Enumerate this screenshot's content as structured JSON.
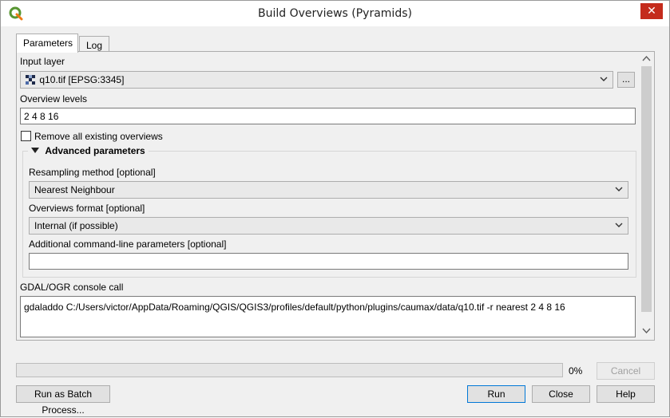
{
  "window": {
    "title": "Build Overviews (Pyramids)"
  },
  "tabs": [
    {
      "label": "Parameters",
      "active": true
    },
    {
      "label": "Log",
      "active": false
    }
  ],
  "params": {
    "input_layer_label": "Input layer",
    "input_layer_value": "q10.tif [EPSG:3345]",
    "browse_label": "...",
    "overview_levels_label": "Overview levels",
    "overview_levels_value": "2 4 8 16",
    "remove_overviews_label": "Remove all existing overviews",
    "remove_overviews_checked": false
  },
  "advanced": {
    "title": "Advanced parameters",
    "resampling_label": "Resampling method [optional]",
    "resampling_value": "Nearest Neighbour",
    "format_label": "Overviews format [optional]",
    "format_value": "Internal (if possible)",
    "extra_label": "Additional command-line parameters [optional]",
    "extra_value": ""
  },
  "console": {
    "label": "GDAL/OGR console call",
    "command": "gdaladdo C:/Users/victor/AppData/Roaming/QGIS/QGIS3/profiles/default/python/plugins/caumax/data/q10.tif -r nearest 2 4 8 16"
  },
  "progress": {
    "value": 0,
    "text": "0%"
  },
  "buttons": {
    "cancel": "Cancel",
    "batch": "Run as Batch Process...",
    "run": "Run",
    "close": "Close",
    "help": "Help"
  },
  "colors": {
    "accent": "#0078d7",
    "close_red": "#c42b1c",
    "qgis_green": "#589632"
  }
}
